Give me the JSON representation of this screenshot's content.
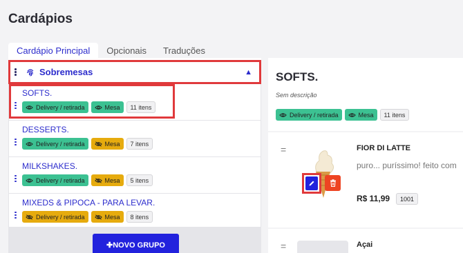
{
  "page": {
    "title": "Cardápios"
  },
  "tabs": [
    {
      "label": "Cardápio Principal",
      "active": true
    },
    {
      "label": "Opcionais",
      "active": false
    },
    {
      "label": "Traduções",
      "active": false
    }
  ],
  "group": {
    "title": "Sobremesas",
    "icon": "fingerprint-icon",
    "expanded": true
  },
  "categories": [
    {
      "name": "SOFTS.",
      "badges": [
        {
          "label": "Delivery / retirada",
          "color": "green",
          "icon": "eye-icon"
        },
        {
          "label": "Mesa",
          "color": "green",
          "icon": "eye-icon"
        }
      ],
      "count": "11 itens"
    },
    {
      "name": "DESSERTS.",
      "badges": [
        {
          "label": "Delivery / retirada",
          "color": "green",
          "icon": "eye-icon"
        },
        {
          "label": "Mesa",
          "color": "yellow",
          "icon": "eye-off-icon"
        }
      ],
      "count": "7 itens"
    },
    {
      "name": "MILKSHAKES.",
      "badges": [
        {
          "label": "Delivery / retirada",
          "color": "green",
          "icon": "eye-icon"
        },
        {
          "label": "Mesa",
          "color": "yellow",
          "icon": "eye-off-icon"
        }
      ],
      "count": "5 itens"
    },
    {
      "name": "MIXEDS & PIPOCA - PARA LEVAR.",
      "badges": [
        {
          "label": "Delivery / retirada",
          "color": "yellow",
          "icon": "eye-off-icon"
        },
        {
          "label": "Mesa",
          "color": "yellow",
          "icon": "eye-off-icon"
        }
      ],
      "count": "8 itens"
    }
  ],
  "new_group_button": "✚NOVO GRUPO",
  "detail": {
    "title": "SOFTS.",
    "description": "Sem descrição",
    "badges": [
      {
        "label": "Delivery / retirada",
        "icon": "eye-icon"
      },
      {
        "label": "Mesa",
        "icon": "eye-icon"
      }
    ],
    "count": "11 itens",
    "products": [
      {
        "name": "FIOR DI LATTE",
        "description": "puro... puríssimo! feito com",
        "price": "R$ 11,99",
        "code": "1001"
      },
      {
        "name": "Açai"
      }
    ]
  },
  "colors": {
    "accent": "#2c2ccc",
    "green_badge": "#3cc192",
    "yellow_badge": "#e6ab0e",
    "highlight": "#e0393b",
    "delete": "#ee4422"
  }
}
